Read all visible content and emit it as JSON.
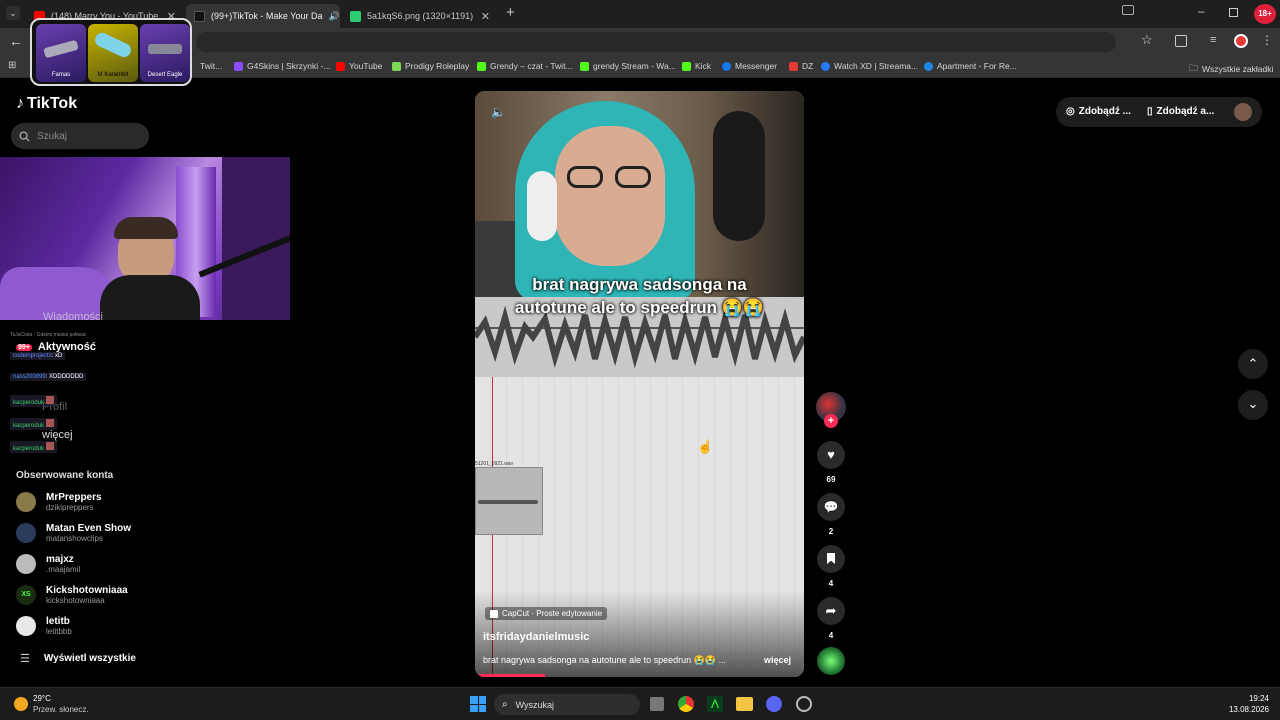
{
  "browser": {
    "tabs": [
      {
        "title": "(148) Marry You - YouTube",
        "color": "#ff0000"
      },
      {
        "title": "(99+)TikTok - Make Your Da",
        "color": "#111111"
      },
      {
        "title": "5a1kqS6.png (1320×1191)",
        "color": "#2ecc71"
      }
    ],
    "new_tab": "+",
    "bookmarks": [
      {
        "label": "Twit...",
        "color": "#888"
      },
      {
        "label": "G4Skins | Skrzynki -...",
        "color": "#8a4dff"
      },
      {
        "label": "YouTube",
        "color": "#ff0000"
      },
      {
        "label": "Prodigy Roleplay",
        "color": "#7ed957"
      },
      {
        "label": "Grendy – czat - Twit...",
        "color": "#53fc18"
      },
      {
        "label": "grendy Stream - Wa...",
        "color": "#53fc18"
      },
      {
        "label": "Kick",
        "color": "#53fc18"
      },
      {
        "label": "Messenger",
        "color": "#1877f2"
      },
      {
        "label": "DZ",
        "color": "#e53935"
      },
      {
        "label": "Watch XD | Streama...",
        "color": "#2979ff"
      },
      {
        "label": "Apartment - For Re...",
        "color": "#1e88e5"
      }
    ],
    "all_bookmarks": "Wszystkie zakładki"
  },
  "tiktok": {
    "logo": "TikTok",
    "search_placeholder": "Szukaj",
    "sidebar_partial": {
      "messages": "Wiadomości",
      "activity": "Aktywność",
      "activity_badge": "99+",
      "profile": "Profil",
      "more": "więcej"
    },
    "followed_header": "Obserwowane konta",
    "followed": [
      {
        "name": "MrPreppers",
        "handle": "dzikipreppers",
        "color": "#8a7a4a"
      },
      {
        "name": "Matan Even Show",
        "handle": "matanshowclips",
        "color": "#2b3b5c"
      },
      {
        "name": "majxz",
        "handle": ".maajamil",
        "color": "#bbbbbb"
      },
      {
        "name": "Kickshotowniaaa",
        "handle": "kickshotowniaaa",
        "color": "#1b2b12"
      },
      {
        "name": "letitb",
        "handle": "letitbbb",
        "color": "#e8e8e8"
      }
    ],
    "show_all": "Wyświetl wszystkie",
    "top_buttons": [
      "Zdobądź ...",
      "Zdobądź a..."
    ],
    "video": {
      "caption_line1": "brat nagrywa sadsonga na",
      "caption_line2": "autotune ale to speedrun 😭😭",
      "capcut": "CapCut · Proste edytowanie",
      "author": "itsfridaydanielmusic",
      "description": "brat nagrywa sadsonga na autotune ale to speedrun 😭😭 ...",
      "more": "więcej",
      "clip_label": "51201_0921.wav"
    },
    "actions": {
      "likes": "69",
      "comments": "2",
      "saves": "4",
      "shares": "4"
    }
  },
  "chat": [
    {
      "user": "codeinprojects",
      "msg": "xD",
      "color": "#6a8cff"
    },
    {
      "user": "nass200899",
      "msg": "XDDDDDDD",
      "color": "#5b8cff"
    },
    {
      "user": "kacperoduk",
      "msg": "",
      "color": "#3ecf6a"
    },
    {
      "user": "kacperoduk",
      "msg": "",
      "color": "#3ecf6a"
    },
    {
      "user": "kacperoduk",
      "msg": "",
      "color": "#3ecf6a"
    }
  ],
  "chat_top_line": "TaJaCiata · Gdzies masial pokwac",
  "taskbar": {
    "weather_temp": "29°C",
    "weather_desc": "Przew. słonecz.",
    "search": "Wyszukaj",
    "time": "19:24",
    "date": "13.08.2026",
    "badge": "18+"
  },
  "overlay_cards": [
    "Famas",
    "M Karambit",
    "Desert Eagle"
  ]
}
